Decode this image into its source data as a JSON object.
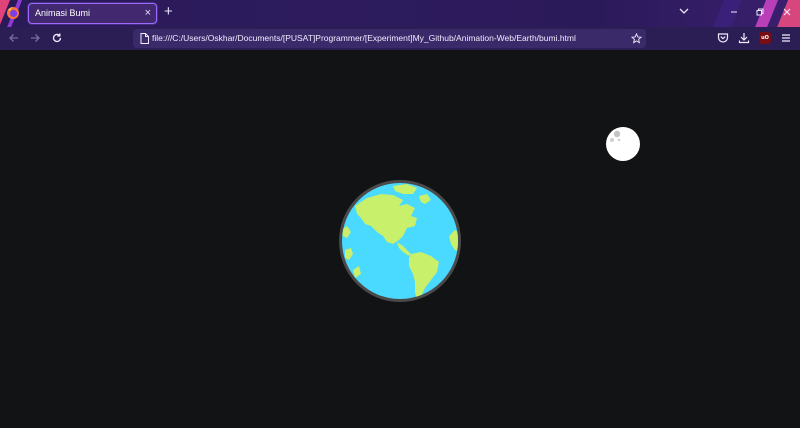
{
  "browser": {
    "tabs": [
      {
        "label": "Animasi Bumi",
        "active": true
      }
    ],
    "new_tab_label": "+",
    "close_tab_label": "×",
    "url": "file:///C:/Users/Oskhar/Documents/[PUSAT]Programmer/[Experiment]My_Github/Animation-Web/Earth/bumi.html",
    "toolbar_icons": [
      "back-icon",
      "forward-icon",
      "reload-icon",
      "page-icon",
      "bookmark-star-icon",
      "pocket-icon",
      "download-icon",
      "ublock-icon",
      "menu-icon"
    ],
    "window_controls": [
      "minimize-icon",
      "maximize-icon",
      "close-icon"
    ],
    "theme_colors": {
      "tabstrip": "#2b1a5a",
      "active_tab": "#42296f",
      "active_tab_border": "#9b6bff",
      "navbar": "#2b1e55",
      "urlbar": "#3a2a6a"
    }
  },
  "page": {
    "background_color": "#121314",
    "earth": {
      "ocean_color": "#4ad9ff",
      "land_color": "#c8f06a",
      "border_color": "#4a4a4a"
    },
    "moon": {
      "color": "#ffffff",
      "crater_color": "#bdbdbd"
    }
  }
}
